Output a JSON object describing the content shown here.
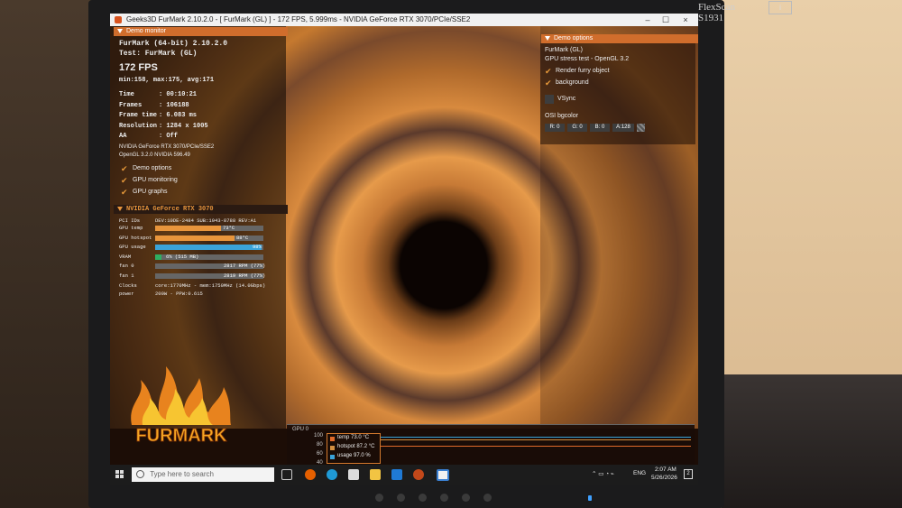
{
  "monitor": {
    "brand": "FlexScan S1931",
    "badge": "i"
  },
  "window": {
    "title": "Geeks3D FurMark 2.10.2.0 - [ FurMark (GL) ] - 172 FPS, 5.999ms - NVIDIA GeForce RTX 3070/PCIe/SSE2",
    "min": "–",
    "max": "☐",
    "close": "×"
  },
  "demo_monitor": {
    "header": "Demo monitor",
    "app": "FurMark (64-bit) 2.10.2.0",
    "test": "Test: FurMark (GL)",
    "fps": "172 FPS",
    "fps_stats": "min:158, max:175, avg:171",
    "rows": [
      {
        "label": "Time",
        "value": ": 00:10:21"
      },
      {
        "label": "Frames",
        "value": ": 106188"
      },
      {
        "label": "Frame time",
        "value": ": 6.083 ms"
      },
      {
        "label": "Resolution",
        "value": ": 1284 x 1005"
      },
      {
        "label": "AA",
        "value": ": Off"
      }
    ],
    "renderer": "NVIDIA GeForce RTX 3070/PCIe/SSE2",
    "gl": "OpenGL 3.2.0 NVIDIA 596.49",
    "options": [
      "Demo options",
      "GPU monitoring",
      "GPU graphs"
    ]
  },
  "gpu": {
    "header": "NVIDIA GeForce RTX 3070",
    "pci": {
      "label": "PCI IDs",
      "value": "DEV:10DE-2484 SUB:1043-8788 REV:A1"
    },
    "bars": [
      {
        "label": "GPU temp",
        "value": "73°C",
        "fraction": 0.61,
        "color": "#e8953c"
      },
      {
        "label": "GPU hotspot",
        "value": "88°C",
        "fraction": 0.73,
        "color": "#e8953c"
      },
      {
        "label": "GPU usage",
        "value": "98%",
        "fraction": 0.98,
        "color": "#3aa3d9"
      },
      {
        "label": "VRAM",
        "value": "6% (515 MB)",
        "fraction": 0.06,
        "color": "#2fae62"
      },
      {
        "label": "fan 0",
        "value": "2817 RPM (77%)",
        "fraction": 0.0,
        "color": "#777777"
      },
      {
        "label": "fan 1",
        "value": "2819 RPM (77%)",
        "fraction": 0.0,
        "color": "#777777"
      }
    ],
    "clocks": {
      "label": "Clocks",
      "value": "core:1770MHz - mem:1750MHz (14.0Gbps)"
    },
    "power": {
      "label": "power",
      "value": "200W - PPW:0.615"
    }
  },
  "demo_options": {
    "header": "Demo options",
    "title": "FurMark (GL)",
    "subtitle": "GPU stress test - OpenGL 3.2",
    "checks": [
      "Render furry object",
      "background"
    ],
    "vsync": "VSync",
    "bgcolor_label": "OSI bgcolor",
    "bgcolor": [
      "R: 0",
      "G: 0",
      "B: 0",
      "A:128"
    ]
  },
  "graph": {
    "label": "GPU 0",
    "ticks": [
      "100",
      "80",
      "60",
      "40"
    ],
    "legend": [
      "temp  73.0 °C",
      "hotspot  87.2 °C",
      "usage  97.0 %"
    ],
    "colors": [
      "#e06a2a",
      "#d49040",
      "#3aa3d9"
    ]
  },
  "logo": "FURMARK",
  "taskbar": {
    "search_placeholder": "Type here to search",
    "lang": "ENG",
    "time": "2:07 AM",
    "date": "5/26/2026",
    "notif": "2"
  }
}
